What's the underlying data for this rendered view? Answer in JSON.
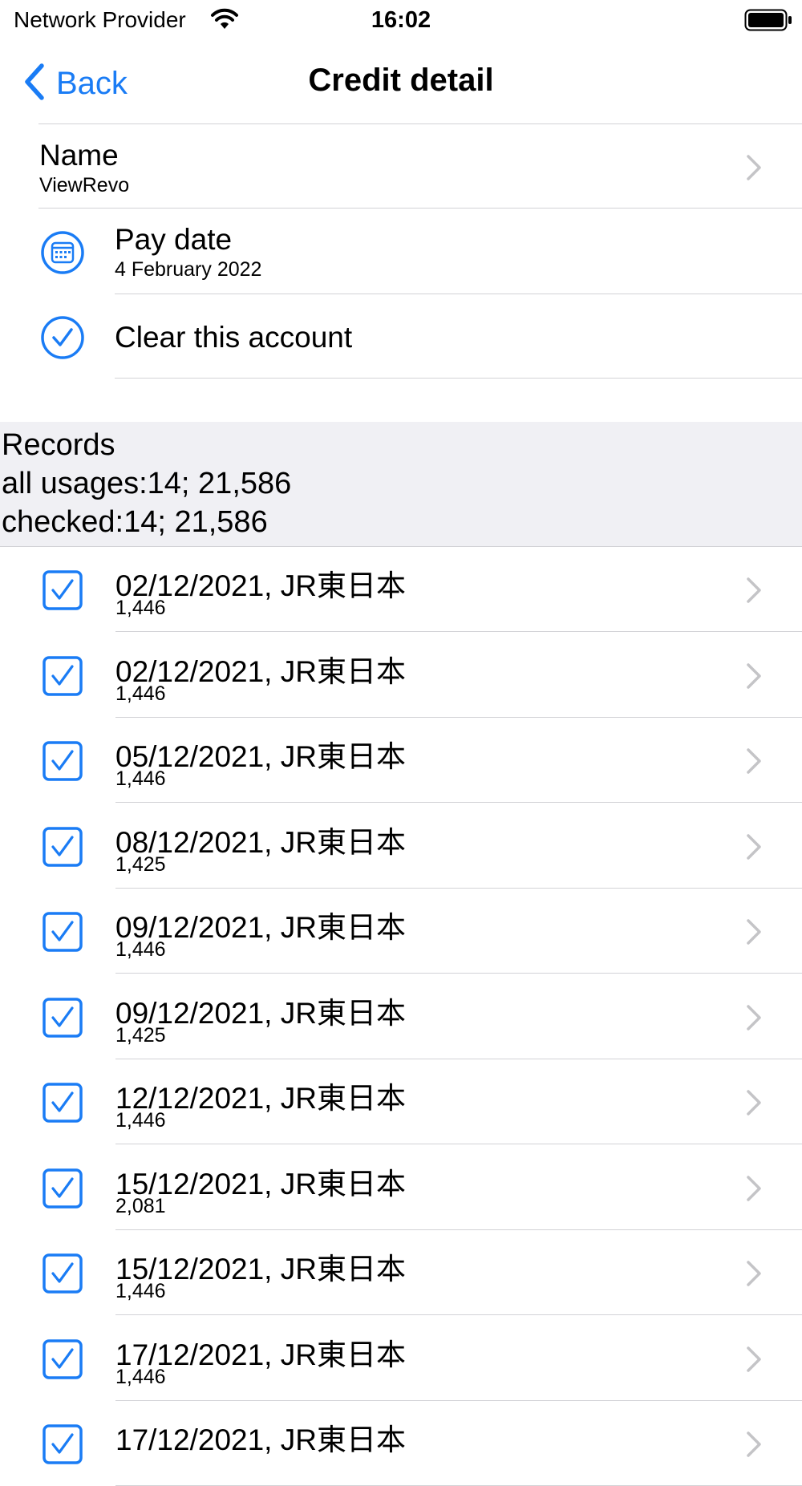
{
  "status_bar": {
    "carrier": "Network Provider",
    "time": "16:02"
  },
  "nav": {
    "back_label": "Back",
    "title": "Credit detail"
  },
  "detail": {
    "name_title": "Name",
    "name_value": "ViewRevo",
    "pay_date_title": "Pay date",
    "pay_date_value": "4 February 2022",
    "clear_label": "Clear this account"
  },
  "records_header": {
    "title": "Records",
    "all_usages": " all usages:14; 21,586",
    "checked": " checked:14; 21,586"
  },
  "records": [
    {
      "title": "02/12/2021, JR東日本",
      "amount": "1,446",
      "checked": true
    },
    {
      "title": "02/12/2021, JR東日本",
      "amount": "1,446",
      "checked": true
    },
    {
      "title": "05/12/2021, JR東日本",
      "amount": "1,446",
      "checked": true
    },
    {
      "title": "08/12/2021, JR東日本",
      "amount": "1,425",
      "checked": true
    },
    {
      "title": "09/12/2021, JR東日本",
      "amount": "1,446",
      "checked": true
    },
    {
      "title": "09/12/2021, JR東日本",
      "amount": "1,425",
      "checked": true
    },
    {
      "title": "12/12/2021, JR東日本",
      "amount": "1,446",
      "checked": true
    },
    {
      "title": "15/12/2021, JR東日本",
      "amount": "2,081",
      "checked": true
    },
    {
      "title": "15/12/2021, JR東日本",
      "amount": "1,446",
      "checked": true
    },
    {
      "title": "17/12/2021, JR東日本",
      "amount": "1,446",
      "checked": true
    },
    {
      "title": "17/12/2021, JR東日本",
      "amount": "",
      "checked": true
    }
  ],
  "colors": {
    "accent": "#1a7cf5",
    "separator": "#d2d2d6",
    "section_bg": "#f0f0f4",
    "chevron": "#c4c4c7"
  },
  "icons": {
    "back": "chevron-left-icon",
    "calendar": "calendar-icon",
    "clear": "checkmark-circle-icon",
    "record_checkbox": "checked-box-icon",
    "disclosure": "chevron-right-icon"
  }
}
